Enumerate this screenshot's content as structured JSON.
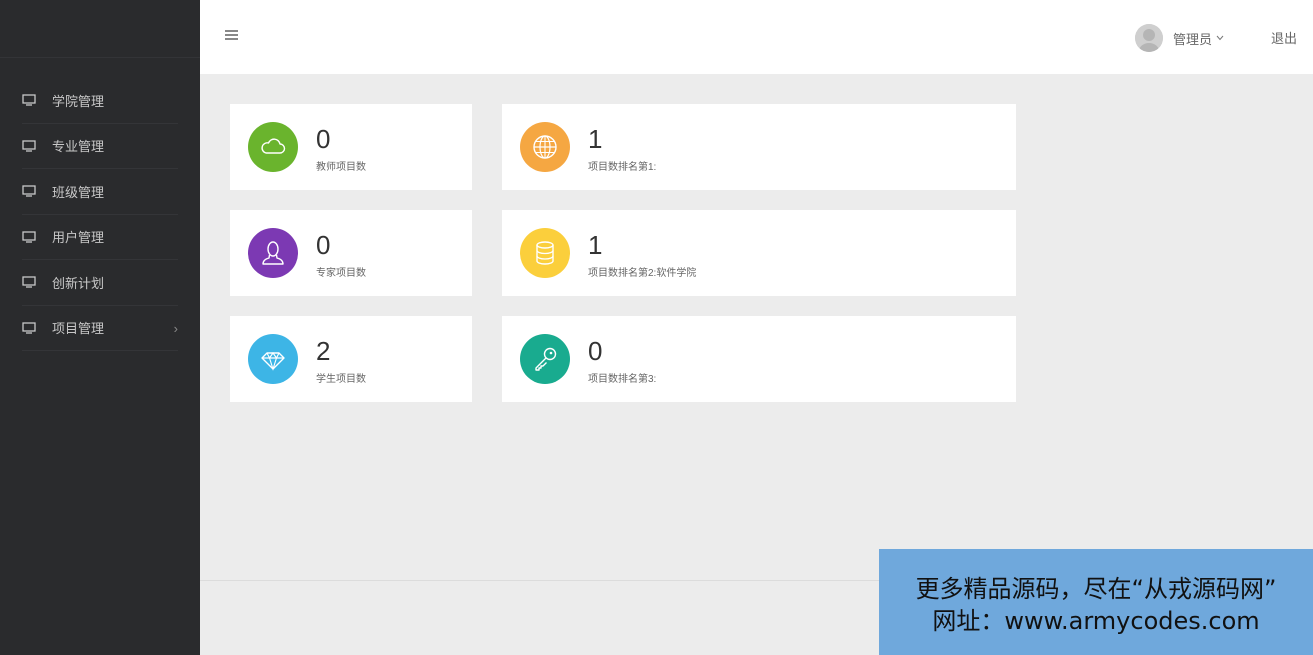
{
  "sidebar": {
    "items": [
      {
        "label": "学院管理",
        "icon": "monitor-icon"
      },
      {
        "label": "专业管理",
        "icon": "monitor-icon"
      },
      {
        "label": "班级管理",
        "icon": "monitor-icon"
      },
      {
        "label": "用户管理",
        "icon": "monitor-icon"
      },
      {
        "label": "创新计划",
        "icon": "monitor-icon"
      },
      {
        "label": "项目管理",
        "icon": "monitor-icon",
        "chevron": "›"
      }
    ]
  },
  "header": {
    "menu_icon": "hamburger-icon",
    "user_name": "管理员",
    "logout": "退出"
  },
  "cards": [
    {
      "value": "0",
      "label": "教师项目数",
      "icon": "cloud-icon",
      "color": "#6ab42d"
    },
    {
      "value": "1",
      "label": "项目数排名第1:",
      "icon": "globe-icon",
      "color": "#f5a742"
    },
    {
      "value": "0",
      "label": "专家项目数",
      "icon": "person-icon",
      "color": "#7c39b3"
    },
    {
      "value": "1",
      "label": "项目数排名第2:软件学院",
      "icon": "database-icon",
      "color": "#fbcf3c"
    },
    {
      "value": "2",
      "label": "学生项目数",
      "icon": "diamond-icon",
      "color": "#3db5e6"
    },
    {
      "value": "0",
      "label": "项目数排名第3:",
      "icon": "key-icon",
      "color": "#19ab8f"
    }
  ],
  "watermark": {
    "line1": "更多精品源码，尽在“从戎源码网”",
    "line2": "网址：www.armycodes.com"
  },
  "colors": {
    "sidebar_bg": "#2a2b2d",
    "content_bg": "#ececec",
    "watermark_bg": "#6fa8dc"
  }
}
